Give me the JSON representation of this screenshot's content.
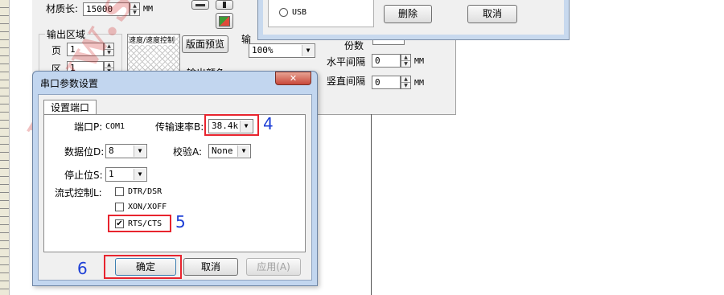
{
  "background": {
    "material_length_label": "材质长:",
    "material_length_value": "15000",
    "material_length_unit": "MM",
    "output_area_label": "输出区域",
    "page_label": "页",
    "page_value": "1",
    "area_label": "区",
    "area_value": "1",
    "preview_thumb_label": "速度/速度控制",
    "layout_preview_button": "版面预览",
    "output_ratio_partial": "输",
    "zoom_value": "100%",
    "output_color_partial": "输出颜色",
    "copies_partial": "份数",
    "h_spacing_label": "水平间隔",
    "h_spacing_value": "0",
    "h_spacing_unit": "MM",
    "v_spacing_label": "竖直间隔",
    "v_spacing_value": "0",
    "v_spacing_unit": "MM"
  },
  "top_dialog": {
    "usb_label": "USB",
    "delete_button": "删除",
    "cancel_button": "取消"
  },
  "dialog": {
    "title": "串口参数设置",
    "close_icon": "close-icon",
    "tab_label": "设置端口",
    "port_label": "端口P:",
    "port_value": "COM1",
    "baud_label": "传输速率B:",
    "baud_value": "38.4k",
    "databits_label": "数据位D:",
    "databits_value": "8",
    "parity_label": "校验A:",
    "parity_value": "None",
    "stopbits_label": "停止位S:",
    "stopbits_value": "1",
    "flow_label": "流式控制L:",
    "flow_dtr": "DTR/DSR",
    "flow_xon": "XON/XOFF",
    "flow_rts": "RTS/CTS",
    "ok_button": "确定",
    "cancel_button": "取消",
    "apply_button": "应用(A)"
  },
  "annotations": {
    "step4": "4",
    "step5": "5",
    "step6": "6"
  },
  "watermark": "www.s",
  "colors": {
    "highlight": "#e8242e",
    "annotation_number": "#1d3fd6",
    "title_bar": "#c2d6ef"
  }
}
